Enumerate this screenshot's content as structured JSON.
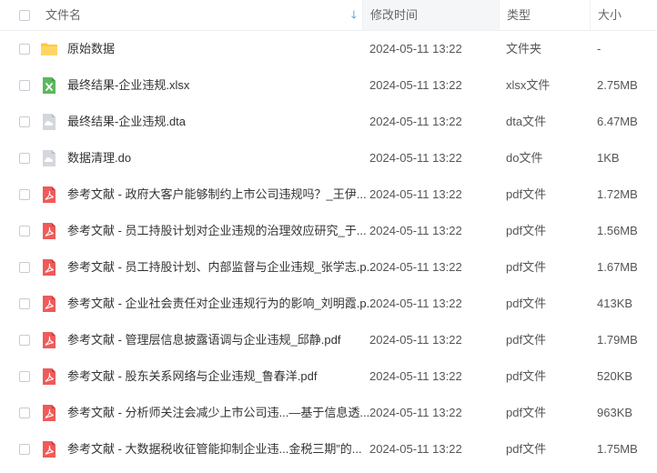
{
  "header": {
    "name_label": "文件名",
    "mtime_label": "修改时间",
    "type_label": "类型",
    "size_label": "大小",
    "sort_icon": "sort-down-arrow"
  },
  "rows": [
    {
      "icon": "folder",
      "name": "原始数据",
      "mtime": "2024-05-11 13:22",
      "type": "文件夹",
      "size": "-"
    },
    {
      "icon": "xlsx",
      "name": "最终结果-企业违规.xlsx",
      "mtime": "2024-05-11 13:22",
      "type": "xlsx文件",
      "size": "2.75MB"
    },
    {
      "icon": "cloud",
      "name": "最终结果-企业违规.dta",
      "mtime": "2024-05-11 13:22",
      "type": "dta文件",
      "size": "6.47MB"
    },
    {
      "icon": "cloud",
      "name": "数据清理.do",
      "mtime": "2024-05-11 13:22",
      "type": "do文件",
      "size": "1KB"
    },
    {
      "icon": "pdf",
      "name": "参考文献 - 政府大客户能够制约上市公司违规吗？_王伊...",
      "mtime": "2024-05-11 13:22",
      "type": "pdf文件",
      "size": "1.72MB"
    },
    {
      "icon": "pdf",
      "name": "参考文献 - 员工持股计划对企业违规的治理效应研究_于...",
      "mtime": "2024-05-11 13:22",
      "type": "pdf文件",
      "size": "1.56MB"
    },
    {
      "icon": "pdf",
      "name": "参考文献 - 员工持股计划、内部监督与企业违规_张学志.p...",
      "mtime": "2024-05-11 13:22",
      "type": "pdf文件",
      "size": "1.67MB"
    },
    {
      "icon": "pdf",
      "name": "参考文献 - 企业社会责任对企业违规行为的影响_刘明霞.p...",
      "mtime": "2024-05-11 13:22",
      "type": "pdf文件",
      "size": "413KB"
    },
    {
      "icon": "pdf",
      "name": "参考文献 - 管理层信息披露语调与企业违规_邱静.pdf",
      "mtime": "2024-05-11 13:22",
      "type": "pdf文件",
      "size": "1.79MB"
    },
    {
      "icon": "pdf",
      "name": "参考文献 - 股东关系网络与企业违规_鲁春洋.pdf",
      "mtime": "2024-05-11 13:22",
      "type": "pdf文件",
      "size": "520KB"
    },
    {
      "icon": "pdf",
      "name": "参考文献 - 分析师关注会减少上市公司违...—基于信息透...",
      "mtime": "2024-05-11 13:22",
      "type": "pdf文件",
      "size": "963KB"
    },
    {
      "icon": "pdf",
      "name": "参考文献 - 大数据税收征管能抑制企业违...金税三期”的...",
      "mtime": "2024-05-11 13:22",
      "type": "pdf文件",
      "size": "1.75MB"
    }
  ],
  "colors": {
    "folder": "#FFC83D",
    "xlsx": "#5CB85C",
    "cloud": "#D4D7DC",
    "pdf": "#F05A5A",
    "accent": "#1E88E5"
  }
}
